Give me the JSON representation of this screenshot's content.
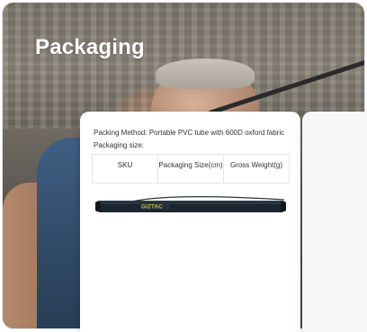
{
  "header": {
    "title": "Packaging"
  },
  "card": {
    "packing_method": "Packing Method: Portable PVC tube with 600D oxford fabric",
    "packaging_size_label": "Packaging size:",
    "table_headers": [
      "SKU",
      "Packaging Size(cm)",
      "Gross Weight(g)"
    ]
  },
  "product_image": {
    "description_icon": "fishing-rod-bag-icon",
    "brand_text": "GIZTAC"
  },
  "colors": {
    "title": "#ffffff",
    "card_bg": "#ffffff",
    "bag": "#1b2530",
    "logo": "#c9b45a"
  }
}
